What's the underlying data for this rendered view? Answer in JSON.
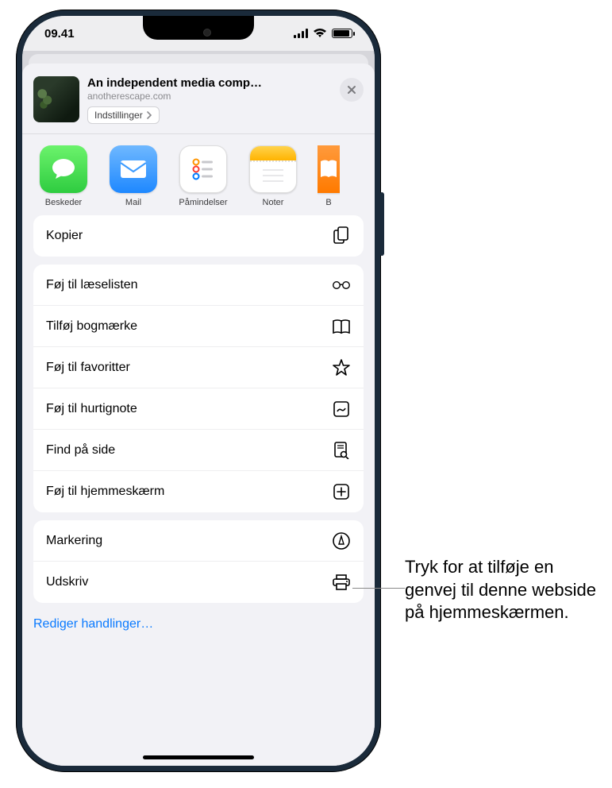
{
  "status": {
    "time": "09.41"
  },
  "header": {
    "title": "An independent media comp…",
    "url": "anotherescape.com",
    "options_label": "Indstillinger"
  },
  "apps": {
    "messages": "Beskeder",
    "mail": "Mail",
    "reminders": "Påmindelser",
    "notes": "Noter",
    "books_partial": "B"
  },
  "actions": {
    "copy": "Kopier",
    "reading_list": "Føj til læselisten",
    "bookmark": "Tilføj bogmærke",
    "favorites": "Føj til favoritter",
    "quick_note": "Føj til hurtignote",
    "find": "Find på side",
    "home_screen": "Føj til hjemmeskærm",
    "markup": "Markering",
    "print": "Udskriv"
  },
  "edit_actions": "Rediger handlinger…",
  "callout": "Tryk for at tilføje en genvej til denne webside på hjemmeskærmen."
}
